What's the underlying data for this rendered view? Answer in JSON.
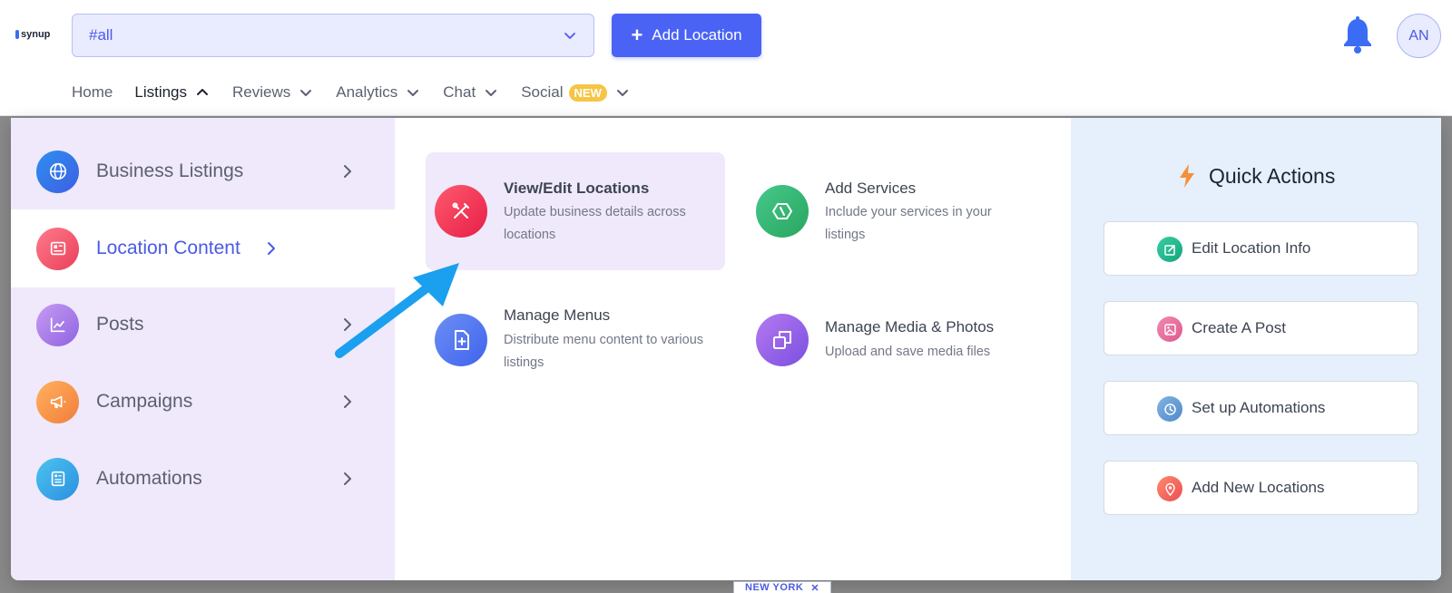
{
  "header": {
    "logo_text": "synup",
    "location_select": {
      "value": "#all"
    },
    "add_location_label": "Add Location",
    "avatar_initials": "AN"
  },
  "nav": {
    "items": [
      {
        "label": "Home"
      },
      {
        "label": "Listings",
        "expanded": true
      },
      {
        "label": "Reviews"
      },
      {
        "label": "Analytics"
      },
      {
        "label": "Chat"
      },
      {
        "label": "Social",
        "badge": "NEW"
      }
    ]
  },
  "menu": {
    "categories": [
      {
        "label": "Business Listings",
        "icon": "globe-icon",
        "color": "#3d7ae6"
      },
      {
        "label": "Location Content",
        "icon": "newspaper-icon",
        "color": "#f05a6c",
        "selected": true
      },
      {
        "label": "Posts",
        "icon": "chart-line-icon",
        "color": "#a678e8"
      },
      {
        "label": "Campaigns",
        "icon": "megaphone-icon",
        "color": "#f59a4a"
      },
      {
        "label": "Automations",
        "icon": "document-list-icon",
        "color": "#3aa7e4"
      }
    ],
    "options": [
      {
        "title": "View/Edit Locations",
        "desc": "Update business details across locations",
        "icon": "tools-icon",
        "highlighted": true
      },
      {
        "title": "Add Services",
        "desc": "Include your services in your listings",
        "icon": "services-hexagon-icon"
      },
      {
        "title": "Manage Menus",
        "desc": "Distribute menu content to various listings",
        "icon": "file-add-icon"
      },
      {
        "title": "Manage Media & Photos",
        "desc": "Upload and save media files",
        "icon": "copy-media-icon"
      }
    ]
  },
  "quick_actions": {
    "title": "Quick Actions",
    "buttons": [
      {
        "label": "Edit Location Info",
        "icon": "edit-icon"
      },
      {
        "label": "Create A Post",
        "icon": "image-icon"
      },
      {
        "label": "Set up Automations",
        "icon": "clock-icon"
      },
      {
        "label": "Add New Locations",
        "icon": "map-pin-icon"
      }
    ]
  },
  "background": {
    "location_tag": "NEW YORK"
  },
  "colors": {
    "accent": "#4a63f5",
    "annotation_arrow": "#1aa0ee"
  }
}
